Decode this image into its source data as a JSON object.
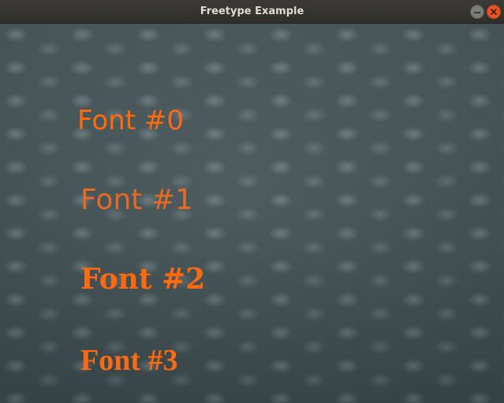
{
  "window": {
    "title": "Freetype Example"
  },
  "canvas": {
    "labels": [
      "Font #0",
      "Font #1",
      "Font #2",
      "Font #3"
    ]
  },
  "colors": {
    "text": "#ff6a10",
    "close_button": "#e95420",
    "titlebar": "#3c3b37"
  },
  "icons": {
    "minimize": "minimize-icon",
    "close": "close-icon"
  }
}
